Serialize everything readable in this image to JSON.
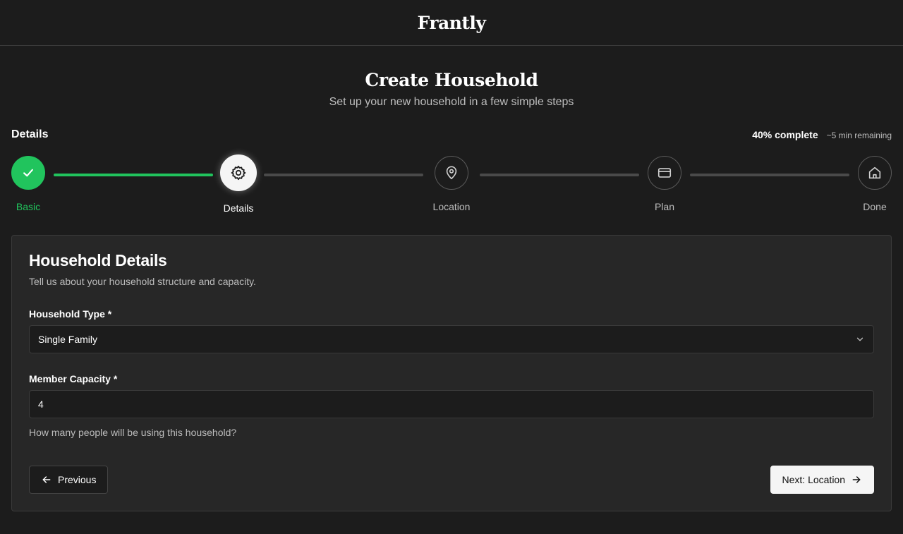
{
  "app": {
    "brand": "Frantly"
  },
  "hero": {
    "title": "Create Household",
    "subtitle": "Set up your new household in a few simple steps"
  },
  "progress": {
    "current_step": "Details",
    "percent_label": "40% complete",
    "remaining": "~5 min remaining",
    "percent": 40
  },
  "steps": [
    {
      "label": "Basic",
      "state": "done",
      "icon": "check-icon"
    },
    {
      "label": "Details",
      "state": "active",
      "icon": "gear-icon"
    },
    {
      "label": "Location",
      "state": "pending",
      "icon": "map-pin-icon"
    },
    {
      "label": "Plan",
      "state": "pending",
      "icon": "credit-card-icon"
    },
    {
      "label": "Done",
      "state": "pending",
      "icon": "home-icon"
    }
  ],
  "form": {
    "title": "Household Details",
    "description": "Tell us about your household structure and capacity.",
    "household_type": {
      "label": "Household Type *",
      "value": "Single Family"
    },
    "member_capacity": {
      "label": "Member Capacity *",
      "value": "4",
      "hint": "How many people will be using this household?"
    }
  },
  "actions": {
    "previous_label": "Previous",
    "next_label": "Next: Location"
  },
  "colors": {
    "success": "#21c45d",
    "background": "#1c1c1c",
    "card": "#272727"
  }
}
